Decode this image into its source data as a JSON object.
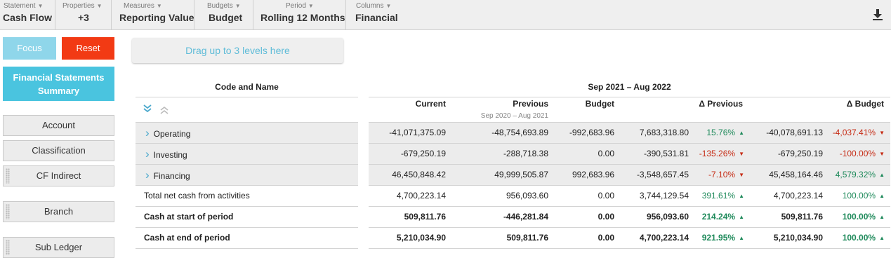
{
  "toolbar": {
    "items": [
      {
        "caption": "Statement",
        "value": "Cash Flow"
      },
      {
        "caption": "Properties",
        "value": "+3"
      },
      {
        "caption": "Measures",
        "value": "Reporting Value"
      },
      {
        "caption": "Budgets",
        "value": "Budget"
      },
      {
        "caption": "Period",
        "value": "Rolling 12 Months"
      },
      {
        "caption": "Columns",
        "value": "Financial"
      }
    ],
    "download_icon": "download-icon"
  },
  "left_panel": {
    "focus_label": "Focus",
    "reset_label": "Reset",
    "summary_line1": "Financial Statements",
    "summary_line2": "Summary",
    "dimensions": [
      "Account",
      "Classification",
      "CF Indirect",
      "Branch",
      "Sub Ledger"
    ]
  },
  "dropzone": {
    "label": "Drag up to 3 levels here"
  },
  "table": {
    "code_header": "Code and Name",
    "period_header": "Sep 2021 – Aug 2022",
    "columns": {
      "current": "Current",
      "previous": "Previous",
      "previous_sub": "Sep 2020 – Aug 2021",
      "budget": "Budget",
      "delta_previous": "Δ Previous",
      "delta_budget": "Δ Budget"
    },
    "rows": [
      {
        "name": "Operating",
        "current": "-41,071,375.09",
        "previous": "-48,754,693.89",
        "budget": "-992,683.96",
        "dprev": "7,683,318.80",
        "dprev_pct": "15.76%",
        "dprev_dir": "up",
        "dbud": "-40,078,691.13",
        "dbud_pct": "-4,037.41%",
        "dbud_dir": "down"
      },
      {
        "name": "Investing",
        "current": "-679,250.19",
        "previous": "-288,718.38",
        "budget": "0.00",
        "dprev": "-390,531.81",
        "dprev_pct": "-135.26%",
        "dprev_dir": "down",
        "dbud": "-679,250.19",
        "dbud_pct": "-100.00%",
        "dbud_dir": "down"
      },
      {
        "name": "Financing",
        "current": "46,450,848.42",
        "previous": "49,999,505.87",
        "budget": "992,683.96",
        "dprev": "-3,548,657.45",
        "dprev_pct": "-7.10%",
        "dprev_dir": "down",
        "dbud": "45,458,164.46",
        "dbud_pct": "4,579.32%",
        "dbud_dir": "up"
      },
      {
        "name": "Total net cash from activities",
        "current": "4,700,223.14",
        "previous": "956,093.60",
        "budget": "0.00",
        "dprev": "3,744,129.54",
        "dprev_pct": "391.61%",
        "dprev_dir": "up",
        "dbud": "4,700,223.14",
        "dbud_pct": "100.00%",
        "dbud_dir": "up"
      },
      {
        "name": "Cash at start of period",
        "current": "509,811.76",
        "previous": "-446,281.84",
        "budget": "0.00",
        "dprev": "956,093.60",
        "dprev_pct": "214.24%",
        "dprev_dir": "up",
        "dbud": "509,811.76",
        "dbud_pct": "100.00%",
        "dbud_dir": "up"
      },
      {
        "name": "Cash at end of period",
        "current": "5,210,034.90",
        "previous": "509,811.76",
        "budget": "0.00",
        "dprev": "4,700,223.14",
        "dprev_pct": "921.95%",
        "dprev_dir": "up",
        "dbud": "5,210,034.90",
        "dbud_pct": "100.00%",
        "dbud_dir": "up"
      }
    ]
  },
  "colors": {
    "focus": "#8fd6ea",
    "reset": "#f23a14",
    "summary": "#4ac4df",
    "positive": "#1f8a5b",
    "negative": "#c62b14"
  }
}
